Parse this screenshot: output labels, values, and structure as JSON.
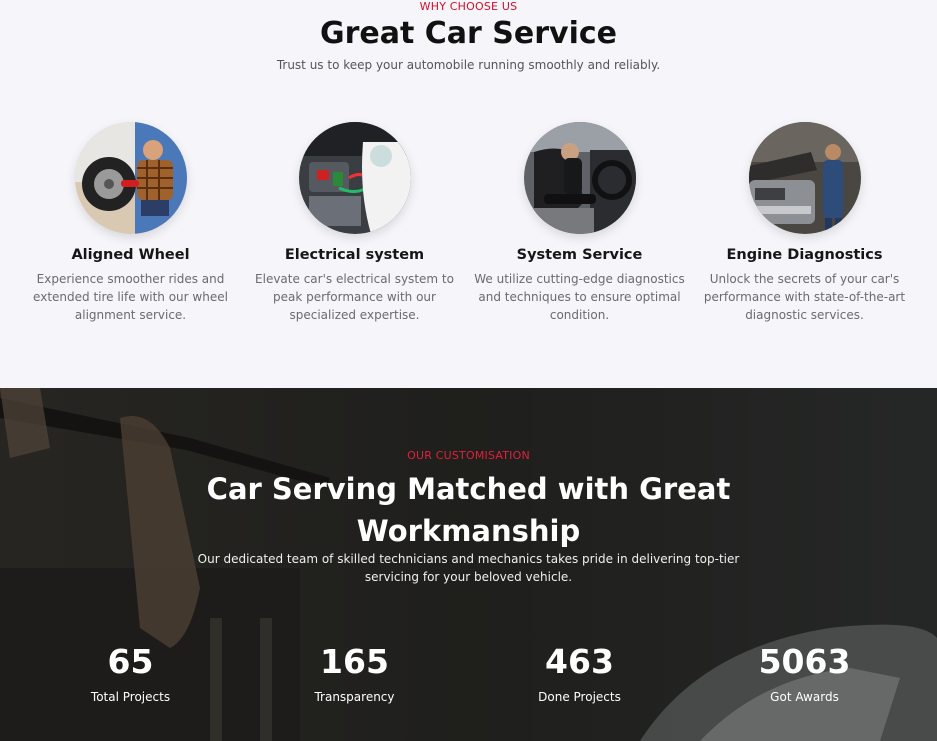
{
  "why": {
    "eyebrow": "WHY CHOOSE US",
    "title": "Great Car Service",
    "subtitle": "Trust us to keep your automobile running smoothly and reliably."
  },
  "services": [
    {
      "title": "Aligned Wheel",
      "text": "Experience smoother rides and extended tire life with our wheel alignment service.",
      "image": "mechanic-wheel-photo"
    },
    {
      "title": "Electrical system",
      "text": "Elevate car's electrical system to peak performance with our specialized expertise.",
      "image": "engine-electrical-photo"
    },
    {
      "title": "System Service",
      "text": "We utilize cutting-edge diagnostics and techniques to ensure optimal condition.",
      "image": "car-interior-photo"
    },
    {
      "title": "Engine Diagnostics",
      "text": "Unlock the secrets of your car's performance with state-of-the-art diagnostic services.",
      "image": "mechanic-hood-photo"
    }
  ],
  "custom": {
    "eyebrow": "OUR CUSTOMISATION",
    "title_line1": "Car Serving Matched with Great",
    "title_line2": "Workmanship",
    "description": "Our dedicated team of skilled technicians and mechanics takes pride in delivering top-tier servicing for your beloved vehicle."
  },
  "stats": [
    {
      "value": "65",
      "label": "Total Projects"
    },
    {
      "value": "165",
      "label": "Transparency"
    },
    {
      "value": "463",
      "label": "Done Projects"
    },
    {
      "value": "5063",
      "label": "Got Awards"
    }
  ],
  "colors": {
    "accent": "#d4102a",
    "heading": "#111111",
    "body_text": "#6b6b6b",
    "section_bg": "#f5f5fa",
    "dark_bg": "#2b2b27"
  }
}
